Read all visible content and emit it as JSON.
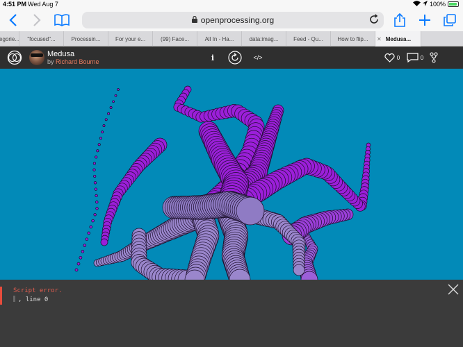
{
  "status_bar": {
    "time": "4:51 PM",
    "date": "Wed Aug 7",
    "battery": "100%",
    "battery_level": 1.0
  },
  "browser": {
    "url": "openprocessing.org",
    "tabs": [
      {
        "label": "egorie..."
      },
      {
        "label": "\"focused\"..."
      },
      {
        "label": "Processin..."
      },
      {
        "label": "For your e..."
      },
      {
        "label": "(99) Face..."
      },
      {
        "label": "All In - Ha..."
      },
      {
        "label": "data:imag..."
      },
      {
        "label": "Feed - Qu..."
      },
      {
        "label": "How to flip..."
      },
      {
        "label": "Medusa..."
      }
    ],
    "active_tab_index": 9
  },
  "sketch": {
    "title": "Medusa",
    "by_prefix": "by",
    "author": "Richard Bourne",
    "info_label": "i",
    "code_label": "</>",
    "likes": "0",
    "comments": "0"
  },
  "colors": {
    "canvas_bg": "#028ab8",
    "tentacle_purple": "#9b1fd9",
    "tentacle_lavender": "#9a86cc",
    "error_red": "#e05c4e"
  },
  "console": {
    "error_title": "Script error.",
    "error_detail": ", line 0"
  }
}
